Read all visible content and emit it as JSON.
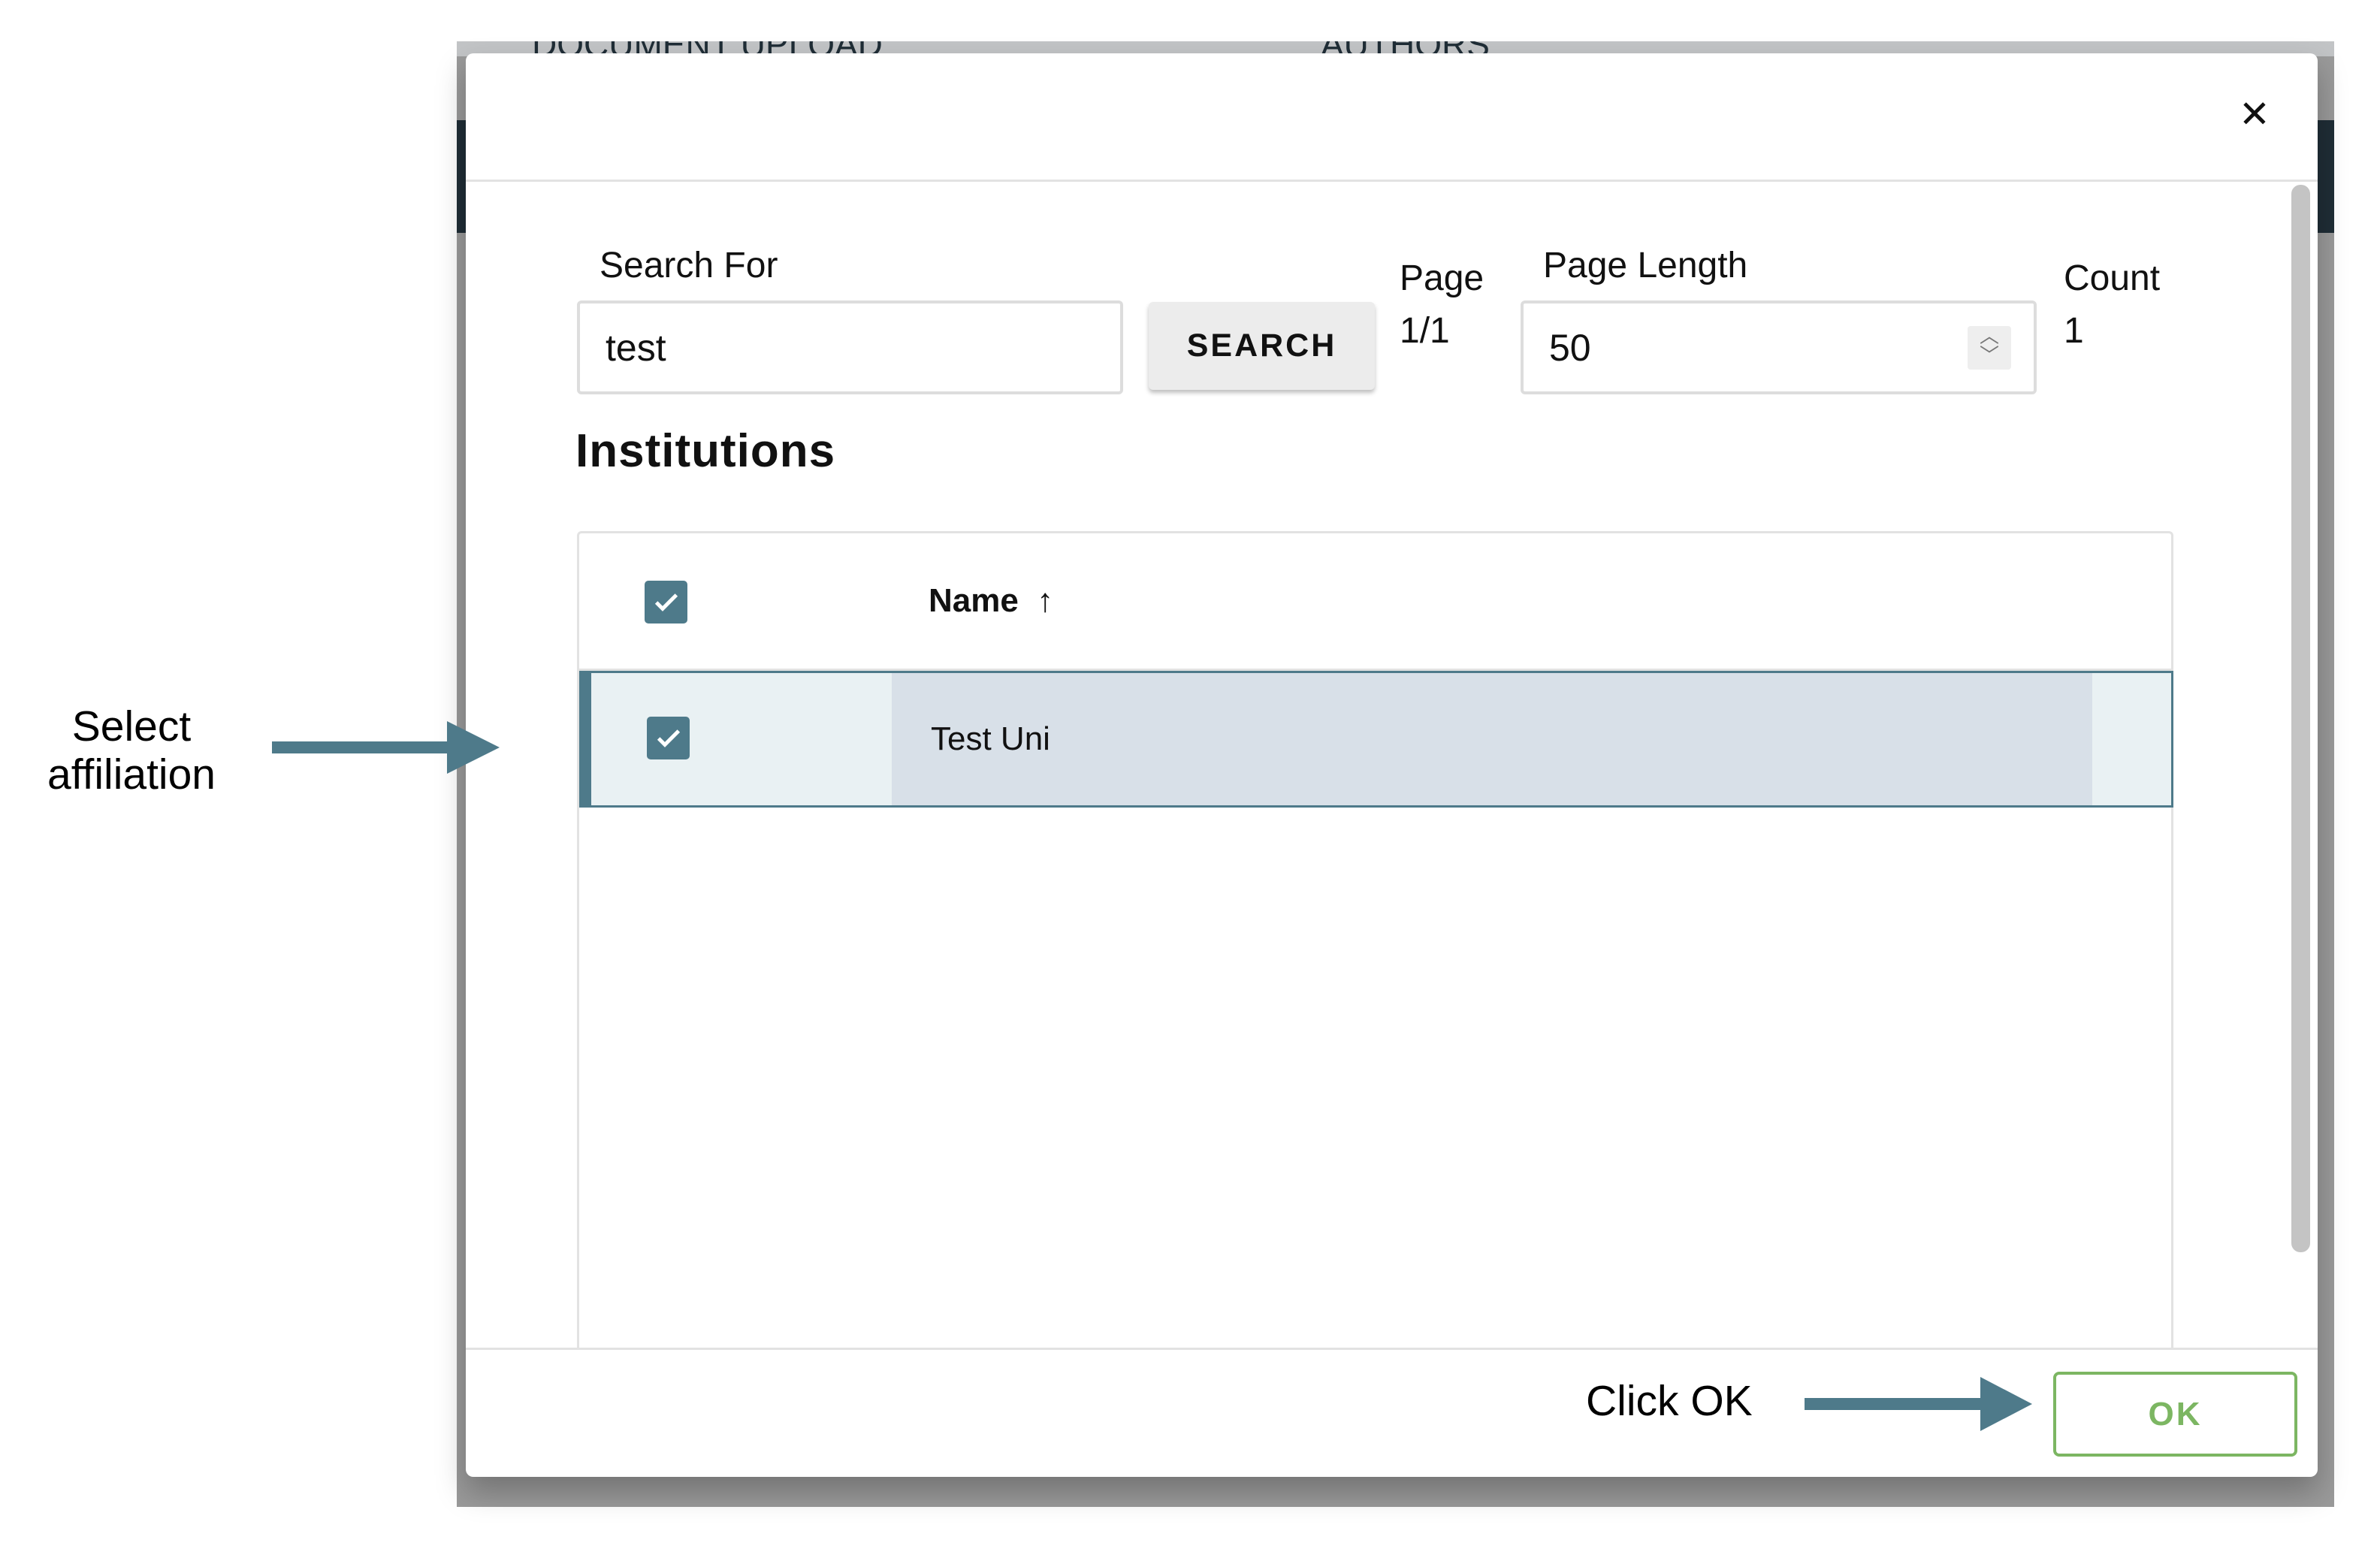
{
  "background": {
    "tabs": [
      "DOCUMENT UPLOAD",
      "AUTHORS"
    ]
  },
  "dialog": {
    "close_icon": "close-icon",
    "search": {
      "label": "Search For",
      "value": "test",
      "button": "SEARCH"
    },
    "page": {
      "label": "Page",
      "value": "1/1"
    },
    "page_length": {
      "label": "Page Length",
      "value": "50"
    },
    "count": {
      "label": "Count",
      "value": "1"
    },
    "section_title": "Institutions",
    "table": {
      "header": {
        "name": "Name",
        "sort": "↑",
        "all_checked": true
      },
      "rows": [
        {
          "name": "Test Uni",
          "checked": true,
          "selected": true
        }
      ]
    },
    "ok_button": "OK"
  },
  "annotations": {
    "select": [
      "Select",
      "affiliation"
    ],
    "click_ok": "Click OK"
  },
  "colors": {
    "accent": "#4e7a8a",
    "ok": "#7cb662",
    "row_bg": "#e9f1f3",
    "cell_bg": "#d8e0e8"
  }
}
